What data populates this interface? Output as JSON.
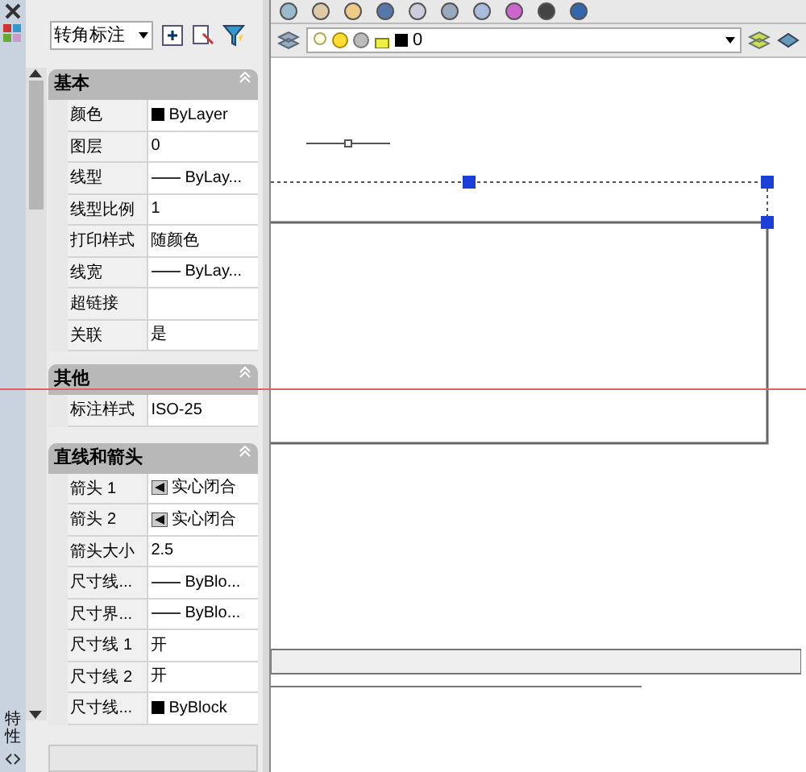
{
  "palette": {
    "title": "特性",
    "object_type": "转角标注",
    "sections": [
      {
        "title": "基本",
        "expanded": true,
        "rows": [
          {
            "label": "颜色",
            "kind": "color",
            "value": "ByLayer"
          },
          {
            "label": "图层",
            "kind": "text",
            "value": "0"
          },
          {
            "label": "线型",
            "kind": "line",
            "value": "ByLay..."
          },
          {
            "label": "线型比例",
            "kind": "text",
            "value": "1"
          },
          {
            "label": "打印样式",
            "kind": "text",
            "value": "随颜色"
          },
          {
            "label": "线宽",
            "kind": "line",
            "value": "ByLay..."
          },
          {
            "label": "超链接",
            "kind": "text",
            "value": ""
          },
          {
            "label": "关联",
            "kind": "text",
            "value": "是"
          }
        ]
      },
      {
        "title": "其他",
        "expanded": true,
        "rows": [
          {
            "label": "标注样式",
            "kind": "text",
            "value": "ISO-25"
          }
        ]
      },
      {
        "title": "直线和箭头",
        "expanded": true,
        "rows": [
          {
            "label": "箭头 1",
            "kind": "arrow",
            "value": "实心闭合"
          },
          {
            "label": "箭头 2",
            "kind": "arrow",
            "value": "实心闭合"
          },
          {
            "label": "箭头大小",
            "kind": "text",
            "value": "2.5"
          },
          {
            "label": "尺寸线...",
            "kind": "line",
            "value": "ByBlo..."
          },
          {
            "label": "尺寸界...",
            "kind": "line",
            "value": "ByBlo..."
          },
          {
            "label": "尺寸线 1",
            "kind": "text",
            "value": "开"
          },
          {
            "label": "尺寸线 2",
            "kind": "text",
            "value": "开"
          },
          {
            "label": "尺寸线...",
            "kind": "color",
            "value": "ByBlock"
          }
        ]
      }
    ]
  },
  "layer_toolbar": {
    "layer": "0"
  }
}
